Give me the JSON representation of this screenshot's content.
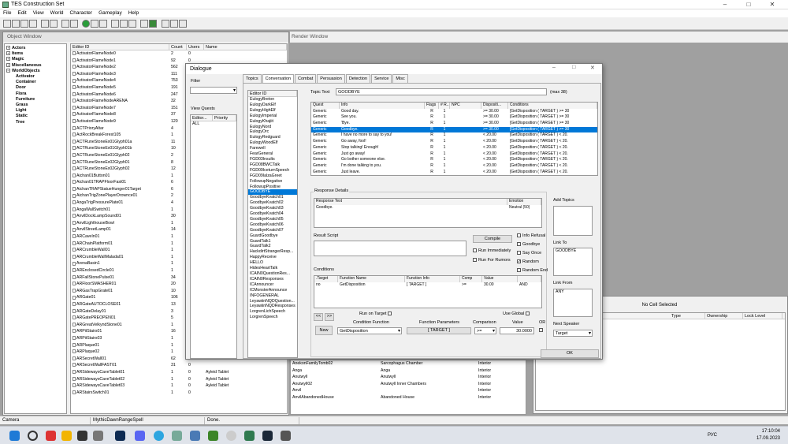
{
  "app": {
    "title": "TES Construction Set",
    "min": "–",
    "max": "□",
    "close": "✕"
  },
  "menu": [
    "File",
    "Edit",
    "View",
    "World",
    "Character",
    "Gameplay",
    "Help"
  ],
  "object_window": {
    "title": "Object Window",
    "tree": [
      {
        "label": "Actors",
        "level": 0,
        "pm": "+"
      },
      {
        "label": "Items",
        "level": 0,
        "pm": "+"
      },
      {
        "label": "Magic",
        "level": 0,
        "pm": "+"
      },
      {
        "label": "Miscellaneous",
        "level": 0,
        "pm": "+"
      },
      {
        "label": "WorldObjects",
        "level": 0,
        "pm": "−"
      },
      {
        "label": "Activator",
        "level": 1
      },
      {
        "label": "Container",
        "level": 1
      },
      {
        "label": "Door",
        "level": 1
      },
      {
        "label": "Flora",
        "level": 1
      },
      {
        "label": "Furniture",
        "level": 1
      },
      {
        "label": "Grass",
        "level": 1
      },
      {
        "label": "Light",
        "level": 1
      },
      {
        "label": "Static",
        "level": 1
      },
      {
        "label": "Tree",
        "level": 1
      }
    ],
    "columns": [
      "Editor ID",
      "Count",
      "Users",
      "Name"
    ],
    "rows": [
      [
        "ActivatorFlameNode0",
        "2",
        "0",
        ""
      ],
      [
        "ActivatorFlameNode1",
        "92",
        "0",
        ""
      ],
      [
        "ActivatorFlameNode2",
        "562",
        "0",
        ""
      ],
      [
        "ActivatorFlameNode3",
        "111",
        "0",
        ""
      ],
      [
        "ActivatorFlameNode4",
        "753",
        "0",
        ""
      ],
      [
        "ActivatorFlameNode5",
        "191",
        "0",
        ""
      ],
      [
        "ActivatorFlameNode6",
        "247",
        "0",
        ""
      ],
      [
        "ActivatorFlameNodeARENA",
        "32",
        "0",
        ""
      ],
      [
        "ActivatorFlameNode7",
        "151",
        "0",
        ""
      ],
      [
        "ActivatorFlameNode8",
        "37",
        "0",
        ""
      ],
      [
        "ActivatorFlameNode9",
        "120",
        "0",
        ""
      ],
      [
        "ACTPrioryAltar",
        "4",
        "0",
        ""
      ],
      [
        "ActRockBreakForest105",
        "1",
        "0",
        ""
      ],
      [
        "ACTRuneStoneEx01Glyph01a",
        "11",
        "0",
        ""
      ],
      [
        "ACTRuneStoneEx01Glyph01b",
        "10",
        "0",
        ""
      ],
      [
        "ACTRuneStoneEx01Glyph02",
        "2",
        "0",
        ""
      ],
      [
        "ACTRuneStoneEx02Glyph01",
        "8",
        "0",
        ""
      ],
      [
        "ACTRuneStoneEx02Glyph02",
        "12",
        "0",
        ""
      ],
      [
        "Aichan01Button01",
        "1",
        "0",
        ""
      ],
      [
        "Aichan01TRAPFloorFast01",
        "6",
        "0",
        ""
      ],
      [
        "AichanTRAPStatueHunger01Target",
        "6",
        "0",
        ""
      ],
      [
        "AichanTrigZonePlayerDrownce01",
        "2",
        "0",
        ""
      ],
      [
        "AngaTrigPressurePlate01",
        "4",
        "0",
        ""
      ],
      [
        "AngaWallSwitch01",
        "1",
        "0",
        ""
      ],
      [
        "AnvilDockLampSound01",
        "30",
        "0",
        ""
      ],
      [
        "AnvilLighthouseBowl",
        "1",
        "0",
        ""
      ],
      [
        "AnvilStreetLamp01",
        "14",
        "0",
        ""
      ],
      [
        "ARCaveIn01",
        "1",
        "0",
        ""
      ],
      [
        "ARChainPlatform01",
        "1",
        "0",
        ""
      ],
      [
        "ARCrumbleWall01",
        "1",
        "0",
        ""
      ],
      [
        "ARCrumbleWallMalada01",
        "1",
        "0",
        ""
      ],
      [
        "ArenaBasin1",
        "1",
        "0",
        ""
      ],
      [
        "AREnclosedCircle01",
        "1",
        "0",
        ""
      ],
      [
        "ARFallStonePulse01",
        "34",
        "0",
        ""
      ],
      [
        "ARFloorSMASHER01",
        "20",
        "0",
        ""
      ],
      [
        "ARGasTrapGrate01",
        "10",
        "0",
        ""
      ],
      [
        "ARGate01",
        "106",
        "0",
        ""
      ],
      [
        "ARGateAUTOCLOSE01",
        "13",
        "0",
        ""
      ],
      [
        "ARGateDelay01",
        "3",
        "0",
        ""
      ],
      [
        "ARGatePREOPEN01",
        "5",
        "0",
        ""
      ],
      [
        "ARGreatVelkyndStone01",
        "1",
        "0",
        ""
      ],
      [
        "ARPitStairs01",
        "16",
        "0",
        ""
      ],
      [
        "ARPitStairs03",
        "1",
        "0",
        ""
      ],
      [
        "ARPlaque01",
        "1",
        "0",
        ""
      ],
      [
        "ARPlaque02",
        "1",
        "0",
        ""
      ],
      [
        "ARSecretWall01",
        "62",
        "0",
        ""
      ],
      [
        "ARSecretWallFAST01",
        "31",
        "0",
        ""
      ],
      [
        "ARSidewaysCaveTablet01",
        "1",
        "0",
        "Ayleid Tablet"
      ],
      [
        "ARSidewaysCaveTablet02",
        "1",
        "0",
        "Ayleid Tablet"
      ],
      [
        "ARSidewaysCaveTablet03",
        "1",
        "0",
        "Ayleid Tablet"
      ],
      [
        "ARStairsSwitch01",
        "1",
        "0",
        ""
      ]
    ]
  },
  "render_window": {
    "title": "Render Window"
  },
  "cell_panel": {
    "no_cell": "No Cell Selected",
    "columns": [
      "Type",
      "Ownership",
      "Lock Level"
    ]
  },
  "bottom_list": [
    [
      "AnekonFamilyTomb02",
      "Sarcophagus Chamber",
      "Interior"
    ],
    [
      "Anga",
      "Anga",
      "Interior"
    ],
    [
      "Anutwyll",
      "Anutwyll",
      "Interior"
    ],
    [
      "Anutwyll02",
      "Anutwyll Inner Chambers",
      "Interior"
    ],
    [
      "Anvil",
      "",
      "Interior"
    ],
    [
      "AnvilAbandonedHouse",
      "Abandoned House",
      "Interior"
    ]
  ],
  "dialogue": {
    "title": "Dialogue",
    "filter_label": "Filter",
    "view_quests_label": "View Quests",
    "quest_cols": [
      "Editor...",
      "Priority"
    ],
    "quest_rows": [
      [
        "ALL",
        ""
      ]
    ],
    "tabs": [
      "Topics",
      "Conversation",
      "Combat",
      "Persuasion",
      "Detection",
      "Service",
      "Misc"
    ],
    "active_tab": "Conversation",
    "editor_id_header": "Editor ID",
    "topics": [
      "EulogyBreton",
      "EulogyDarkElf",
      "EulogyHighElf",
      "EulogyImperial",
      "EulogyKhajiit",
      "EulogyNord",
      "EulogyOrc",
      "EulogyRedguard",
      "EulogyWoodElf",
      "Farewell",
      "FearGeneral",
      "FGD03Insults",
      "FGD08BWCTalk",
      "FGD09IceturnSpeech",
      "FGD09IalzaGreet",
      "FollowupNegative",
      "FollowupPositive",
      "GOODBYE",
      "GoodbyeKvatch01",
      "GoodbyeKvatch02",
      "GoodbyeKvatch03",
      "GoodbyeKvatch04",
      "GoodbyeKvatch05",
      "GoodbyeKvatch06",
      "GoodbyeKvatch07",
      "GuardGoodbye",
      "GuardTalk1",
      "GuardTalk2",
      "HackdirtStrangerResp...",
      "HappyReceive",
      "HELLO",
      "HidesHeartTalk",
      "ICAIN0QuestionRes...",
      "ICAIN0Responses",
      "ICAnnouncer",
      "ICMonsterAnnounce",
      "INFOGENERAL",
      "LeyawiinNQDQuestion...",
      "LeyawiinNQDResponses",
      "LorgrenLichSpeech",
      "LorgrenSpeech"
    ],
    "selected_topic": "GOODBYE",
    "topic_text_label": "Topic Text",
    "topic_text": "GOODBYE",
    "max_label": "(max 38)",
    "info_cols": [
      "Quest",
      "Info",
      "Flags",
      "# R...",
      "NPC",
      "Dispositi...",
      "Conditions"
    ],
    "info_rows": [
      [
        "Generic",
        "Good day.",
        "R",
        "1",
        "",
        ">= 30.00",
        "[GetDisposition ( TARGET ) >= 30"
      ],
      [
        "Generic",
        "See you.",
        "R",
        "1",
        "",
        ">= 30.00",
        "[GetDisposition ( TARGET ) >= 30"
      ],
      [
        "Generic",
        "'Bye.",
        "R",
        "1",
        "",
        ">= 30.00",
        "[GetDisposition ( TARGET ) >= 30"
      ],
      [
        "Generic",
        "Goodbye.",
        "R",
        "1",
        "",
        ">= 30.00",
        "[GetDisposition ( TARGET ) >= 30"
      ],
      [
        "Generic",
        "I have no more to say to you!",
        "R",
        "1",
        "",
        "< 20.00",
        "[GetDisposition ( TARGET ) < 20."
      ],
      [
        "Generic",
        "Go away, fool!",
        "R",
        "1",
        "",
        "< 20.00",
        "[GetDisposition ( TARGET ) < 20."
      ],
      [
        "Generic",
        "Stop talking! Enough!",
        "R",
        "1",
        "",
        "< 20.00",
        "[GetDisposition ( TARGET ) < 20."
      ],
      [
        "Generic",
        "Just go away!",
        "R",
        "1",
        "",
        "< 20.00",
        "[GetDisposition ( TARGET ) < 20."
      ],
      [
        "Generic",
        "Go bother someone else.",
        "R",
        "1",
        "",
        "< 20.00",
        "[GetDisposition ( TARGET ) < 20."
      ],
      [
        "Generic",
        "I'm done talking to you.",
        "R",
        "1",
        "",
        "< 20.00",
        "[GetDisposition ( TARGET ) < 20."
      ],
      [
        "Generic",
        "Just leave.",
        "R",
        "1",
        "",
        "< 20.00",
        "[GetDisposition ( TARGET ) < 20."
      ]
    ],
    "selected_info_row": 3,
    "response_details_label": "Response Details",
    "resp_cols": [
      "Response Text",
      "Emotion"
    ],
    "resp_rows": [
      [
        "Goodbye.",
        "Neutral (50)"
      ]
    ],
    "add_topics_label": "Add Topics",
    "link_to_label": "Link To",
    "link_to": [
      "GOODBYE"
    ],
    "link_from_label": "Link From",
    "link_from": [
      "ANY"
    ],
    "result_script_label": "Result Script",
    "compile_label": "Compile",
    "run_immediately": "Run Immediately",
    "run_for_rumors": "Run For Rumors",
    "info_refusal": "Info Refusal",
    "goodbye": "Goodbye",
    "say_once": "Say Once",
    "random": "Random",
    "random_end": "Random End",
    "conditions_label": "Conditions",
    "cond_cols": [
      ".Target",
      "Function Name",
      "Function Info",
      "Comp",
      "Value",
      ""
    ],
    "cond_rows": [
      [
        "no",
        "GetDisposition",
        "[ TARGET ]",
        ">=",
        "30.00",
        "AND"
      ]
    ],
    "run_on_target": "Run on Target",
    "use_global": "Use Global",
    "condition_function_label": "Condition Function",
    "function_parameters_label": "Function Parameters",
    "comparison_label": "Comparison",
    "value_label": "Value",
    "or_label": "OR",
    "new_label": "New",
    "prev_label": "<<",
    "next_label": ">>",
    "condition_function": "GetDisposition",
    "function_parameters": "[ TARGET ]",
    "comparison": ">=",
    "value": "30.0000",
    "next_speaker_label": "Next Speaker",
    "next_speaker": "Target",
    "ok_label": "OK"
  },
  "status": {
    "left": "Camera",
    "mid": "MythicDawnRangeSpell",
    "right": "Done."
  },
  "taskbar": {
    "lang": "РУС",
    "time": "17:10:04",
    "date": "17.09.2023"
  }
}
